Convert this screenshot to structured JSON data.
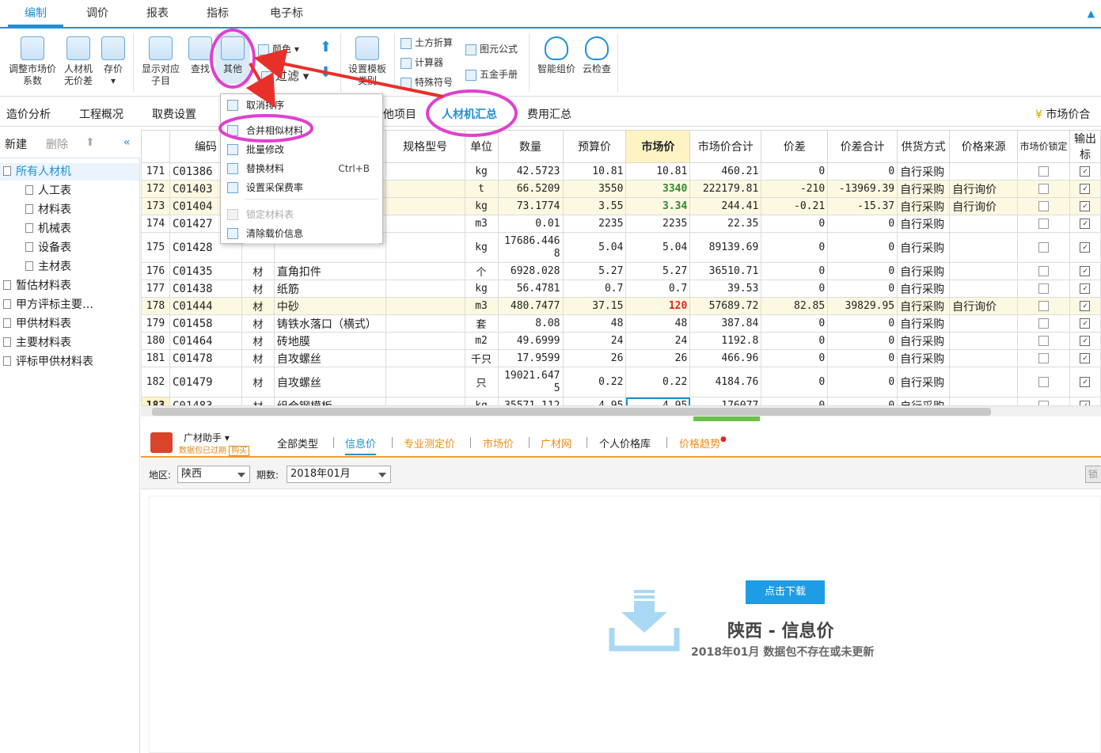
{
  "top_tabs": [
    "编制",
    "调价",
    "报表",
    "指标",
    "电子标"
  ],
  "ribbon": {
    "adjust_market_coef": [
      "调整市场价",
      "系数"
    ],
    "labor_no_diff": [
      "人材机",
      "无价差"
    ],
    "save_price": "存价",
    "show_sub": [
      "显示对应",
      "子目"
    ],
    "find": "查找",
    "other": "其他",
    "color": "颜色",
    "filter": "过滤",
    "template": [
      "设置模板",
      "类别"
    ],
    "earthwork": "土方折算",
    "calculator": "计算器",
    "special_symbol": "特殊符号",
    "formula": "图元公式",
    "hardware": "五金手册",
    "smart_price": "智能组价",
    "cloud_check": "云检查"
  },
  "sub_tabs": [
    "造价分析",
    "工程概况",
    "取费设置",
    "他项目",
    "人材机汇总",
    "费用汇总"
  ],
  "sub_right": "市场价合",
  "left_toolbar": {
    "new": "新建",
    "delete": "删除"
  },
  "tree": [
    {
      "label": "所有人材机",
      "level": 0
    },
    {
      "label": "人工表",
      "level": 1
    },
    {
      "label": "材料表",
      "level": 1
    },
    {
      "label": "机械表",
      "level": 1
    },
    {
      "label": "设备表",
      "level": 1
    },
    {
      "label": "主材表",
      "level": 1
    },
    {
      "label": "暂估材料表",
      "level": 0
    },
    {
      "label": "甲方评标主要…",
      "level": 0
    },
    {
      "label": "甲供材料表",
      "level": 0
    },
    {
      "label": "主要材料表",
      "level": 0
    },
    {
      "label": "评标甲供材料表",
      "level": 0
    }
  ],
  "table": {
    "headers": [
      "",
      "编码",
      "",
      "",
      "规格型号",
      "单位",
      "数量",
      "预算价",
      "市场价",
      "市场价合计",
      "价差",
      "价差合计",
      "供货方式",
      "价格来源",
      "市场价锁定",
      "输出标"
    ],
    "rows": [
      {
        "no": "171",
        "code": "C01386",
        "type": "",
        "name": "",
        "spec": "",
        "unit": "kg",
        "qty": "42.5723",
        "budget": "10.81",
        "market": "10.81",
        "total": "460.21",
        "diff": "0",
        "diff_total": "0",
        "supply": "自行采购",
        "source": ""
      },
      {
        "no": "172",
        "code": "C01403",
        "type": "",
        "name": "",
        "spec": "",
        "unit": "t",
        "qty": "66.5209",
        "budget": "3550",
        "market": "3340",
        "total": "222179.81",
        "diff": "-210",
        "diff_total": "-13969.39",
        "supply": "自行采购",
        "source": "自行询价"
      },
      {
        "no": "173",
        "code": "C01404",
        "type": "",
        "name": "",
        "spec": "",
        "unit": "kg",
        "qty": "73.1774",
        "budget": "3.55",
        "market": "3.34",
        "total": "244.41",
        "diff": "-0.21",
        "diff_total": "-15.37",
        "supply": "自行采购",
        "source": "自行询价"
      },
      {
        "no": "174",
        "code": "C01427",
        "type": "",
        "name": "",
        "spec": "",
        "unit": "m3",
        "qty": "0.01",
        "budget": "2235",
        "market": "2235",
        "total": "22.35",
        "diff": "0",
        "diff_total": "0",
        "supply": "自行采购",
        "source": ""
      },
      {
        "no": "175",
        "code": "C01428",
        "type": "",
        "name": "",
        "spec": "",
        "unit": "kg",
        "qty": "17686.4468",
        "budget": "5.04",
        "market": "5.04",
        "total": "89139.69",
        "diff": "0",
        "diff_total": "0",
        "supply": "自行采购",
        "source": ""
      },
      {
        "no": "176",
        "code": "C01435",
        "type": "材",
        "name": "直角扣件",
        "spec": "",
        "unit": "个",
        "qty": "6928.028",
        "budget": "5.27",
        "market": "5.27",
        "total": "36510.71",
        "diff": "0",
        "diff_total": "0",
        "supply": "自行采购",
        "source": ""
      },
      {
        "no": "177",
        "code": "C01438",
        "type": "材",
        "name": "纸筋",
        "spec": "",
        "unit": "kg",
        "qty": "56.4781",
        "budget": "0.7",
        "market": "0.7",
        "total": "39.53",
        "diff": "0",
        "diff_total": "0",
        "supply": "自行采购",
        "source": ""
      },
      {
        "no": "178",
        "code": "C01444",
        "type": "材",
        "name": "中砂",
        "spec": "",
        "unit": "m3",
        "qty": "480.7477",
        "budget": "37.15",
        "market": "120",
        "total": "57689.72",
        "diff": "82.85",
        "diff_total": "39829.95",
        "supply": "自行采购",
        "source": "自行询价"
      },
      {
        "no": "179",
        "code": "C01458",
        "type": "材",
        "name": "铸铁水落口（横式）",
        "spec": "",
        "unit": "套",
        "qty": "8.08",
        "budget": "48",
        "market": "48",
        "total": "387.84",
        "diff": "0",
        "diff_total": "0",
        "supply": "自行采购",
        "source": ""
      },
      {
        "no": "180",
        "code": "C01464",
        "type": "材",
        "name": "砖地膜",
        "spec": "",
        "unit": "m2",
        "qty": "49.6999",
        "budget": "24",
        "market": "24",
        "total": "1192.8",
        "diff": "0",
        "diff_total": "0",
        "supply": "自行采购",
        "source": ""
      },
      {
        "no": "181",
        "code": "C01478",
        "type": "材",
        "name": "自攻螺丝",
        "spec": "",
        "unit": "千只",
        "qty": "17.9599",
        "budget": "26",
        "market": "26",
        "total": "466.96",
        "diff": "0",
        "diff_total": "0",
        "supply": "自行采购",
        "source": ""
      },
      {
        "no": "182",
        "code": "C01479",
        "type": "材",
        "name": "自攻螺丝",
        "spec": "",
        "unit": "只",
        "qty": "19021.6475",
        "budget": "0.22",
        "market": "0.22",
        "total": "4184.76",
        "diff": "0",
        "diff_total": "0",
        "supply": "自行采购",
        "source": ""
      },
      {
        "no": "183",
        "code": "C01483",
        "type": "材",
        "name": "组合钢模板",
        "spec": "",
        "unit": "kg",
        "qty": "35571.112",
        "budget": "4.95",
        "market": "4.95",
        "total": "176077",
        "diff": "0",
        "diff_total": "0",
        "supply": "自行采购",
        "source": ""
      }
    ]
  },
  "menu": [
    {
      "label": "取消排序",
      "disabled": false,
      "shortcut": ""
    },
    {
      "label": "合并相似材料",
      "disabled": false,
      "shortcut": ""
    },
    {
      "label": "批量修改",
      "disabled": false,
      "shortcut": ""
    },
    {
      "label": "替换材料",
      "disabled": false,
      "shortcut": "Ctrl+B"
    },
    {
      "label": "设置采保费率",
      "disabled": false,
      "shortcut": ""
    },
    {
      "label": "锁定材料表",
      "disabled": true,
      "shortcut": ""
    },
    {
      "label": "清除载价信息",
      "disabled": false,
      "shortcut": ""
    }
  ],
  "bottom": {
    "assistant": "广材助手",
    "assistant_status": "数据包已过期",
    "buy": "购买",
    "tabs": [
      "全部类型",
      "信息价",
      "专业测定价",
      "市场价",
      "广材网",
      "个人价格库",
      "价格趋势"
    ],
    "region_label": "地区:",
    "region": "陕西",
    "period_label": "期数:",
    "period": "2018年01月",
    "lock_btn": "锁",
    "download_btn": "点击下载",
    "info_title": "陕西 - 信息价",
    "info_sub": "2018年01月 数据包不存在或未更新"
  },
  "colors": {
    "accent": "#1e90d6",
    "annotation": "#e040d0",
    "arrow": "#e8302a",
    "orange": "#f08c1a"
  }
}
